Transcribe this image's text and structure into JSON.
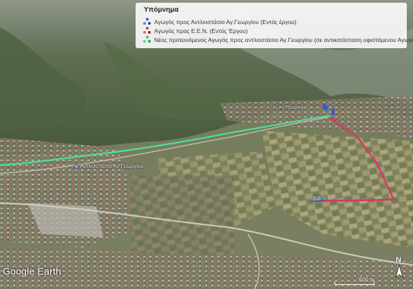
{
  "legend": {
    "title": "Υπόμνημα",
    "items": [
      {
        "label": "Αγωγός προς Αντλιοστάσιο Αγ.Γεωργίου (Εντός έργου)",
        "icon": "dots-blue-icon",
        "colors": [
          "#3a5ed8",
          "#5b7ff0",
          "#2c47b0"
        ]
      },
      {
        "label": "Αγωγός προς Ε.Ε.Ν. (Εντός Έργου)",
        "icon": "dots-red-icon",
        "colors": [
          "#d23b3b",
          "#e56a6a",
          "#a82424"
        ]
      },
      {
        "label": "Νέος προτεινόμενος Αγωγός προς αντλιοστάσιο Αγ.Γεωργίου (σε αντικατάσταση υφιστάμενου Αγωγού)",
        "icon": "dots-green-icon",
        "colors": [
          "#3dbf7a",
          "#58d99a",
          "#2a9c5d"
        ]
      }
    ]
  },
  "map": {
    "labels": {
      "pump_station": "Αντλιοστάσιο Αγ.Γεωργίου",
      "top_right": "Αγ.Γεώργιος",
      "een": "Ε.Ε.Ν."
    },
    "route_colors": {
      "green": "#4ee0a0",
      "red": "#e0306a",
      "blue": "#2f5be0"
    }
  },
  "brand": {
    "logo_text": "Google Earth"
  },
  "scale": {
    "label": "600 m"
  },
  "compass": {
    "north": "N"
  }
}
